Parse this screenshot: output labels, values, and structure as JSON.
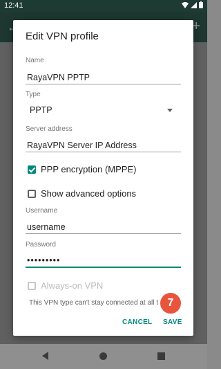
{
  "status_bar": {
    "time": "12:41"
  },
  "dialog": {
    "title": "Edit VPN profile",
    "name_label": "Name",
    "name_value": "RayaVPN PPTP",
    "type_label": "Type",
    "type_value": "PPTP",
    "server_label": "Server address",
    "server_value": "RayaVPN Server IP Address",
    "ppp_encryption_label": "PPP encryption (MPPE)",
    "ppp_encryption_checked": true,
    "advanced_label": "Show advanced options",
    "advanced_checked": false,
    "username_label": "Username",
    "username_value": "username",
    "password_label": "Password",
    "password_value": "•••••••••",
    "always_on_label": "Always-on VPN",
    "always_on_note": "This VPN type can't stay connected at all t",
    "cancel_label": "CANCEL",
    "save_label": "SAVE"
  },
  "badge": {
    "text": "7",
    "color": "#e8553d"
  },
  "colors": {
    "accent": "#00897b"
  }
}
